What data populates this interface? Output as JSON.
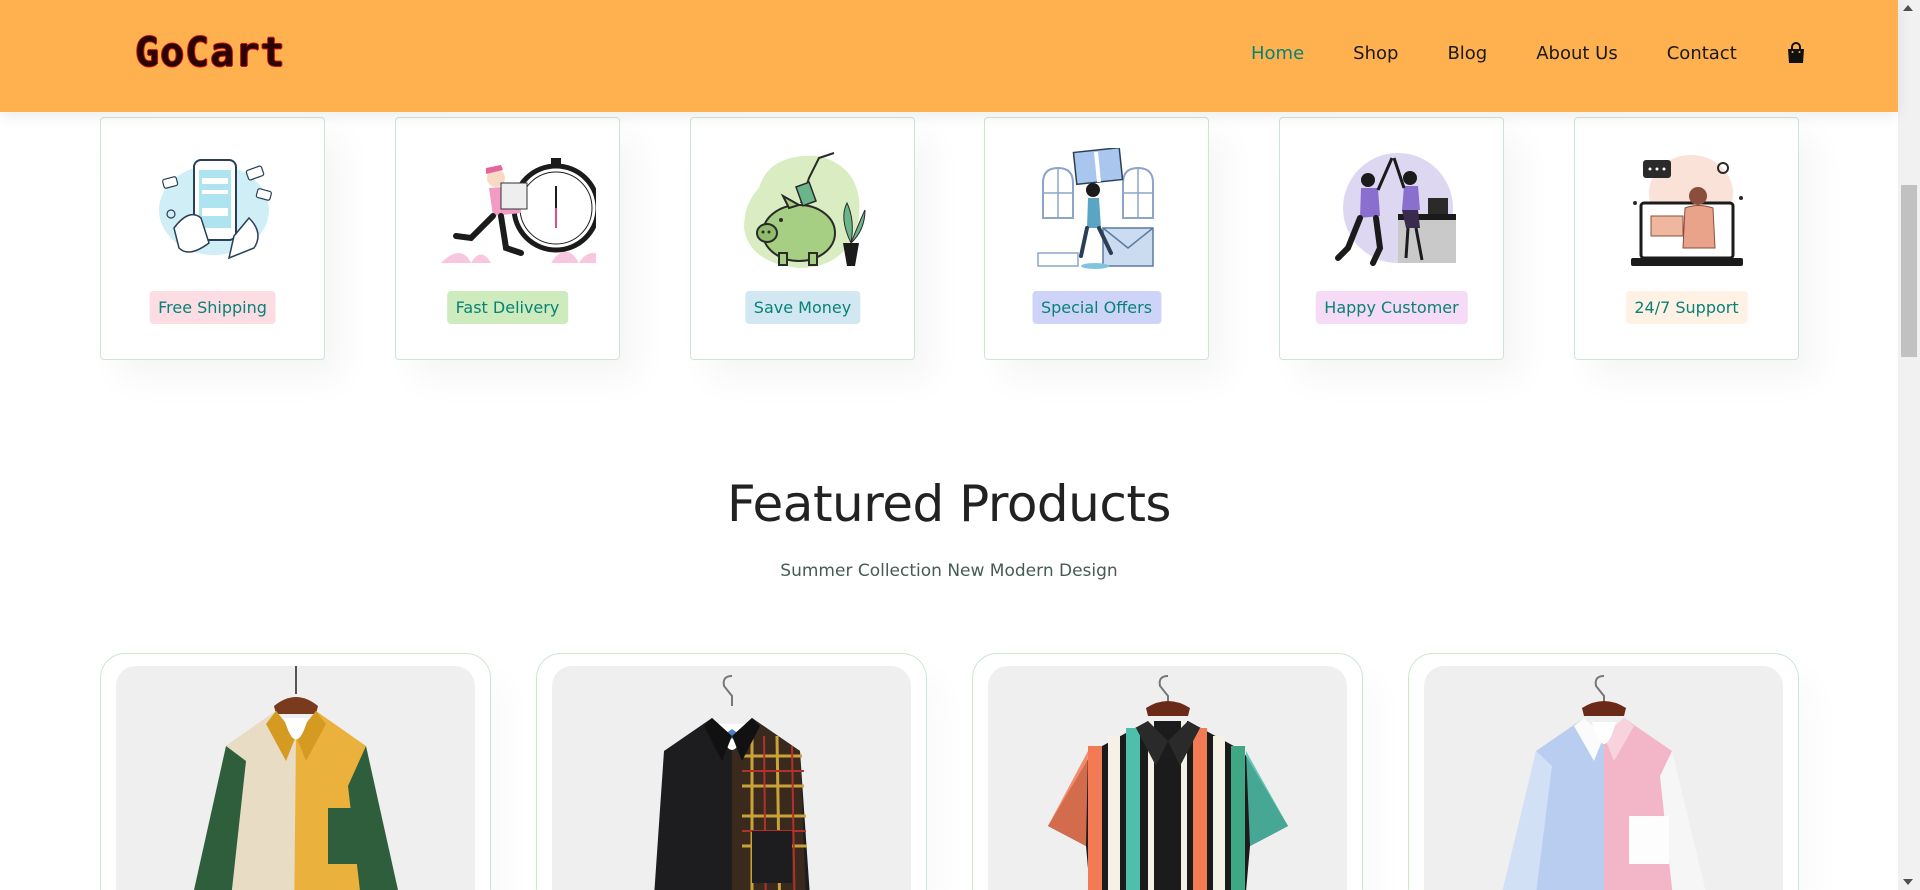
{
  "header": {
    "logo": "GoCart",
    "nav": [
      {
        "label": "Home",
        "active": true
      },
      {
        "label": "Shop",
        "active": false
      },
      {
        "label": "Blog",
        "active": false
      },
      {
        "label": "About Us",
        "active": false
      },
      {
        "label": "Contact",
        "active": false
      }
    ],
    "cart_icon": "shopping-bag-icon",
    "background_color": "#ffb04f",
    "active_color": "#088178"
  },
  "features": [
    {
      "label": "Free Shipping",
      "badge_color": "#fddde4",
      "icon": "payment-phone-illustration"
    },
    {
      "label": "Fast Delivery",
      "badge_color": "#cdebbc",
      "icon": "delivery-clock-illustration"
    },
    {
      "label": "Save Money",
      "badge_color": "#d1e8f2",
      "icon": "piggy-bank-illustration"
    },
    {
      "label": "Special Offers",
      "badge_color": "#cdd4f8",
      "icon": "gift-offer-illustration"
    },
    {
      "label": "Happy Customer",
      "badge_color": "#f6dbf6",
      "icon": "high-five-illustration"
    },
    {
      "label": "24/7 Support",
      "badge_color": "#fff2e5",
      "icon": "laptop-support-illustration"
    }
  ],
  "featured": {
    "title": "Featured Products",
    "subtitle": "Summer Collection New Modern Design"
  },
  "products": [
    {
      "image": "colorblock-shirt-yellow-green"
    },
    {
      "image": "black-corduroy-plaid-shirt"
    },
    {
      "image": "striped-short-sleeve-shirt"
    },
    {
      "image": "blue-pink-colorblock-shirt"
    }
  ]
}
